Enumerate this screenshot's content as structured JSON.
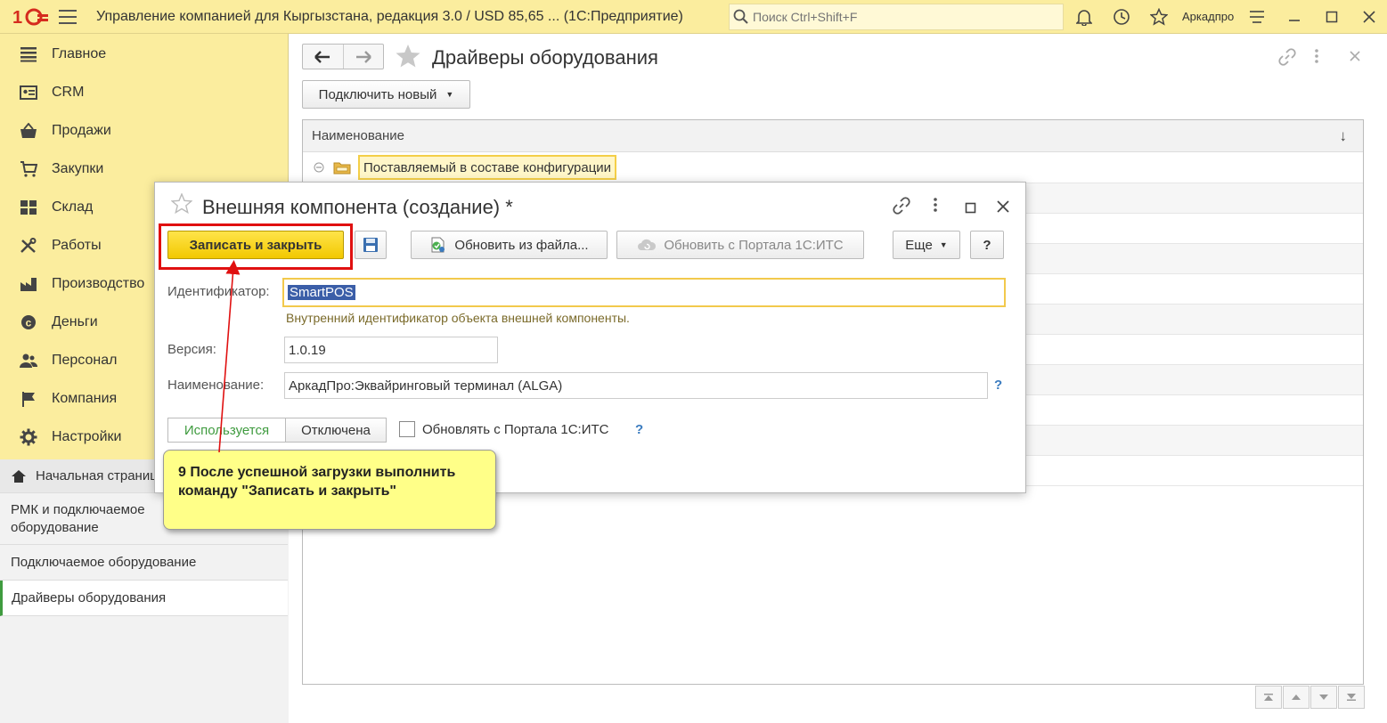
{
  "titlebar": {
    "app_title": "Управление компанией для Кыргызстана, редакция 3.0 / USD 85,65 ...  (1С:Предприятие)",
    "search_placeholder": "Поиск Ctrl+Shift+F",
    "user_name": "Аркадпро"
  },
  "sidebar": {
    "items": [
      {
        "label": "Главное",
        "icon": "list-icon"
      },
      {
        "label": "CRM",
        "icon": "crm-icon"
      },
      {
        "label": "Продажи",
        "icon": "basket-icon"
      },
      {
        "label": "Закупки",
        "icon": "cart-icon"
      },
      {
        "label": "Склад",
        "icon": "warehouse-icon"
      },
      {
        "label": "Работы",
        "icon": "tools-icon"
      },
      {
        "label": "Производство",
        "icon": "factory-icon"
      },
      {
        "label": "Деньги",
        "icon": "money-icon"
      },
      {
        "label": "Персонал",
        "icon": "people-icon"
      },
      {
        "label": "Компания",
        "icon": "flag-icon"
      },
      {
        "label": "Настройки",
        "icon": "gear-icon"
      }
    ],
    "links": [
      {
        "label": "Начальная страница"
      },
      {
        "label": "РМК и подключаемое оборудование"
      },
      {
        "label": "Подключаемое оборудование"
      },
      {
        "label": "Драйверы оборудования"
      }
    ]
  },
  "main": {
    "title": "Драйверы оборудования",
    "connect_new_label": "Подключить новый",
    "column_name": "Наименование",
    "sort_indicator": "↓",
    "group_row_label": "Поставляемый в составе конфигурации"
  },
  "dialog": {
    "title": "Внешняя компонента (создание) *",
    "save_close_label": "Записать и закрыть",
    "update_from_file_label": "Обновить из файла...",
    "update_from_portal_label": "Обновить с Портала 1С:ИТС",
    "more_label": "Еще",
    "help_label": "?",
    "identifier_label": "Идентификатор:",
    "identifier_value": "SmartPOS",
    "identifier_hint": "Внутренний идентификатор объекта внешней компоненты.",
    "version_label": "Версия:",
    "version_value": "1.0.19",
    "name_label": "Наименование:",
    "name_value": "АркадПро:Эквайринговый терминал (ALGA)",
    "switch_used": "Используется",
    "switch_disabled": "Отключена",
    "update_checkbox_label": "Обновлять с Портала 1С:ИТС",
    "question_mark": "?"
  },
  "callout": {
    "text": "9 После успешной загрузки выполнить команду \"Записать и закрыть\""
  },
  "colors": {
    "sidebar_bg": "#fbed9e",
    "primary_button": "#f2c800",
    "highlight_border": "#e01010",
    "callout_bg": "#ffff88",
    "active_green": "#3f9b3f"
  }
}
